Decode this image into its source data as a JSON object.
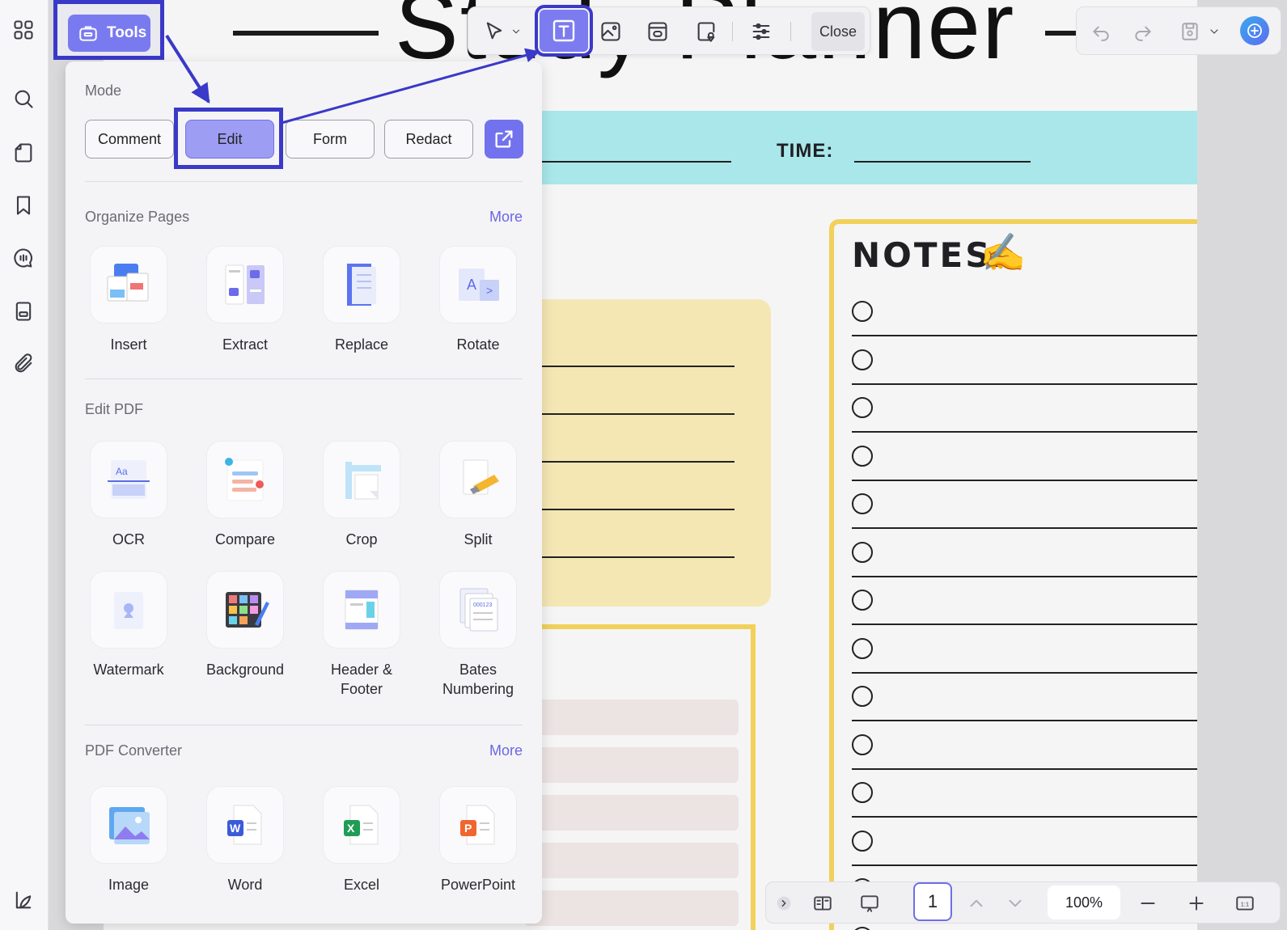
{
  "document": {
    "title": "Study Planner",
    "time_label": "TIME:",
    "notes_title": "NOTES:",
    "notes_emoji": "✍️"
  },
  "toolbar": {
    "close_label": "Close"
  },
  "tools_button": {
    "label": "Tools"
  },
  "panel": {
    "mode_title": "Mode",
    "modes": [
      "Comment",
      "Edit",
      "Form",
      "Redact"
    ],
    "active_mode": "Edit",
    "organize": {
      "title": "Organize Pages",
      "more": "More",
      "items": [
        "Insert",
        "Extract",
        "Replace",
        "Rotate"
      ]
    },
    "edit_pdf": {
      "title": "Edit PDF",
      "items": [
        "OCR",
        "Compare",
        "Crop",
        "Split",
        "Watermark",
        "Background",
        "Header & Footer",
        "Bates Numbering"
      ]
    },
    "converter": {
      "title": "PDF Converter",
      "more": "More",
      "items": [
        "Image",
        "Word",
        "Excel",
        "PowerPoint"
      ]
    }
  },
  "bottom_bar": {
    "page_number": "1",
    "zoom": "100%"
  },
  "icons": {
    "rail": [
      "apps-grid-icon",
      "search-icon",
      "page-icon",
      "bookmark-icon",
      "comment-icon",
      "form-icon",
      "attachment-icon",
      "theme-icon"
    ],
    "toolbar": [
      "select-cursor-icon",
      "text-tool-icon",
      "image-tool-icon",
      "link-tool-icon",
      "location-tool-icon",
      "settings-sliders-icon"
    ]
  },
  "colors": {
    "accent": "#7a7af0",
    "highlight": "#3a39c8",
    "notes_border": "#f1d15a",
    "banner": "#a9e7ea"
  }
}
